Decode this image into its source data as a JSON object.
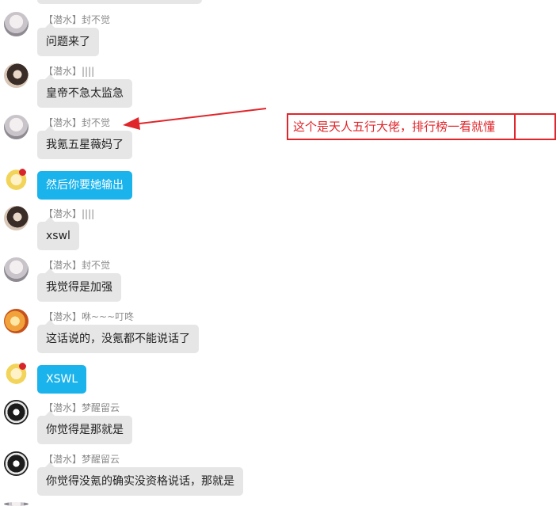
{
  "messages": [
    {
      "name": "【潜水】封不觉",
      "text": "问题来了"
    },
    {
      "name": "【潜水】||||",
      "text": "皇帝不急太监急"
    },
    {
      "name": "【潜水】封不觉",
      "text": "我氪五星薇妈了"
    },
    {
      "name": "",
      "text": "然后你要她输出"
    },
    {
      "name": "【潜水】||||",
      "text": "xswl"
    },
    {
      "name": "【潜水】封不觉",
      "text": "我觉得是加强"
    },
    {
      "name": "【潜水】咻~~~叮咚",
      "text": "这话说的，没氪都不能说话了"
    },
    {
      "name": "",
      "text": "XSWL"
    },
    {
      "name": "【潜水】梦醒留云",
      "text": "你觉得是那就是"
    },
    {
      "name": "【潜水】梦醒留云",
      "text": "你觉得没氪的确实没资格说话，那就是"
    }
  ],
  "annotation": {
    "text": "这个是天人五行大佬，排行榜一看就懂",
    "color": "#e0262b"
  },
  "colors": {
    "self_bubble": "#1ab3ec",
    "other_bubble": "#e6e6e6"
  }
}
